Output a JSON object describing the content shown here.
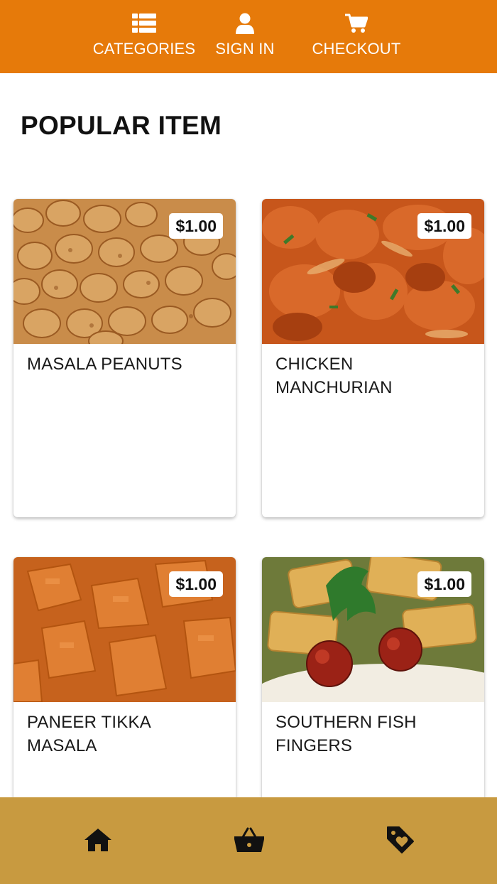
{
  "header": {
    "nav": [
      {
        "label": "CATEGORIES",
        "icon": "list-icon"
      },
      {
        "label": "SIGN IN",
        "icon": "user-icon"
      },
      {
        "label": "CHECKOUT",
        "icon": "cart-icon"
      }
    ]
  },
  "main": {
    "title": "POPULAR ITEM",
    "items": [
      {
        "name": "MASALA PEANUTS",
        "price": "$1.00"
      },
      {
        "name": "CHICKEN MANCHURIAN",
        "price": "$1.00"
      },
      {
        "name": "PANEER TIKKA MASALA",
        "price": "$1.00"
      },
      {
        "name": "SOUTHERN FISH FINGERS",
        "price": "$1.00"
      }
    ]
  },
  "footer": {
    "buttons": [
      {
        "icon": "home-icon"
      },
      {
        "icon": "basket-icon"
      },
      {
        "icon": "tag-heart-icon"
      }
    ]
  },
  "colors": {
    "header_bg": "#e67a0a",
    "footer_bg": "#c89a40",
    "text": "#111111"
  }
}
